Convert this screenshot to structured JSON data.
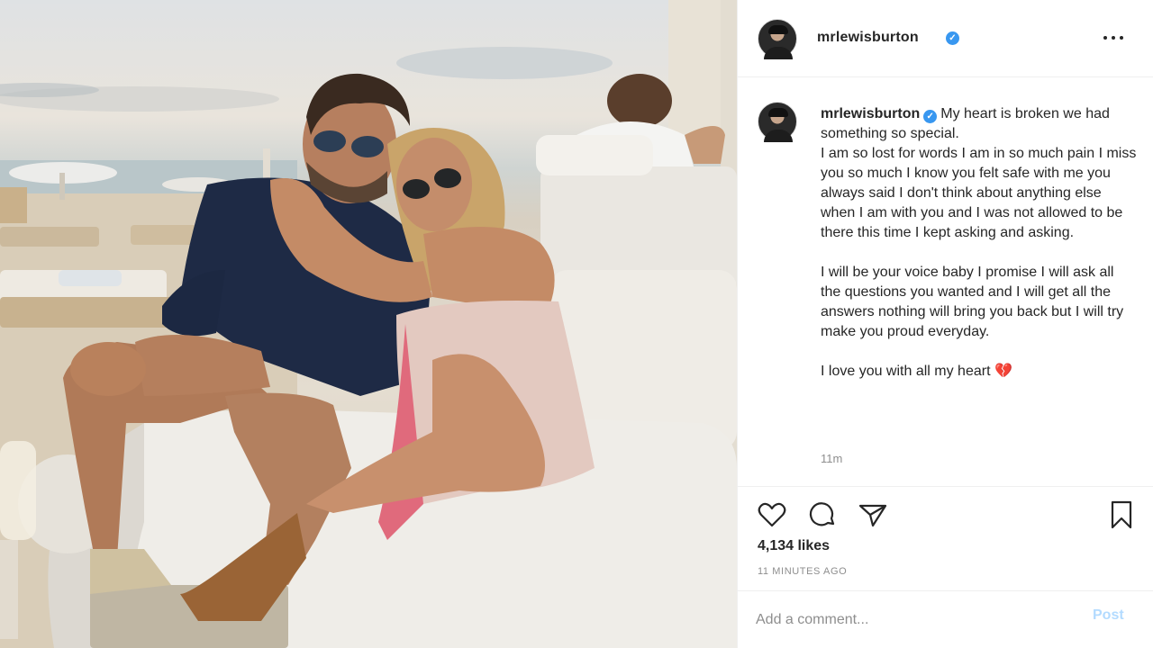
{
  "post": {
    "username": "mrlewisburton",
    "verified_icon": "verified-badge-icon",
    "caption_para1": "My heart is broken we had something so special.\nI am so lost for words I am in so much pain I miss you so much I know you felt safe with me you always said I don't think about anything else when I am with you and I was not allowed to be there this time I kept asking and asking.",
    "caption_para2": "I will be your voice baby I promise I will ask all the questions you wanted and I will get all the answers nothing will bring you back but I will try make you proud everyday.",
    "caption_para3": "I love you with all my heart",
    "caption_emoji": "💔",
    "caption_time": "11m",
    "likes": "4,134 likes",
    "time_ago": "11 MINUTES AGO"
  },
  "comment": {
    "placeholder": "Add a comment...",
    "post_label": "Post"
  },
  "icons": {
    "more": "more-options-icon",
    "like": "heart-icon",
    "comment": "comment-icon",
    "share": "share-icon",
    "save": "bookmark-icon"
  },
  "colors": {
    "verified": "#3897f0",
    "post_button_disabled": "#b3dbff",
    "secondary_text": "#8e8e8e"
  }
}
